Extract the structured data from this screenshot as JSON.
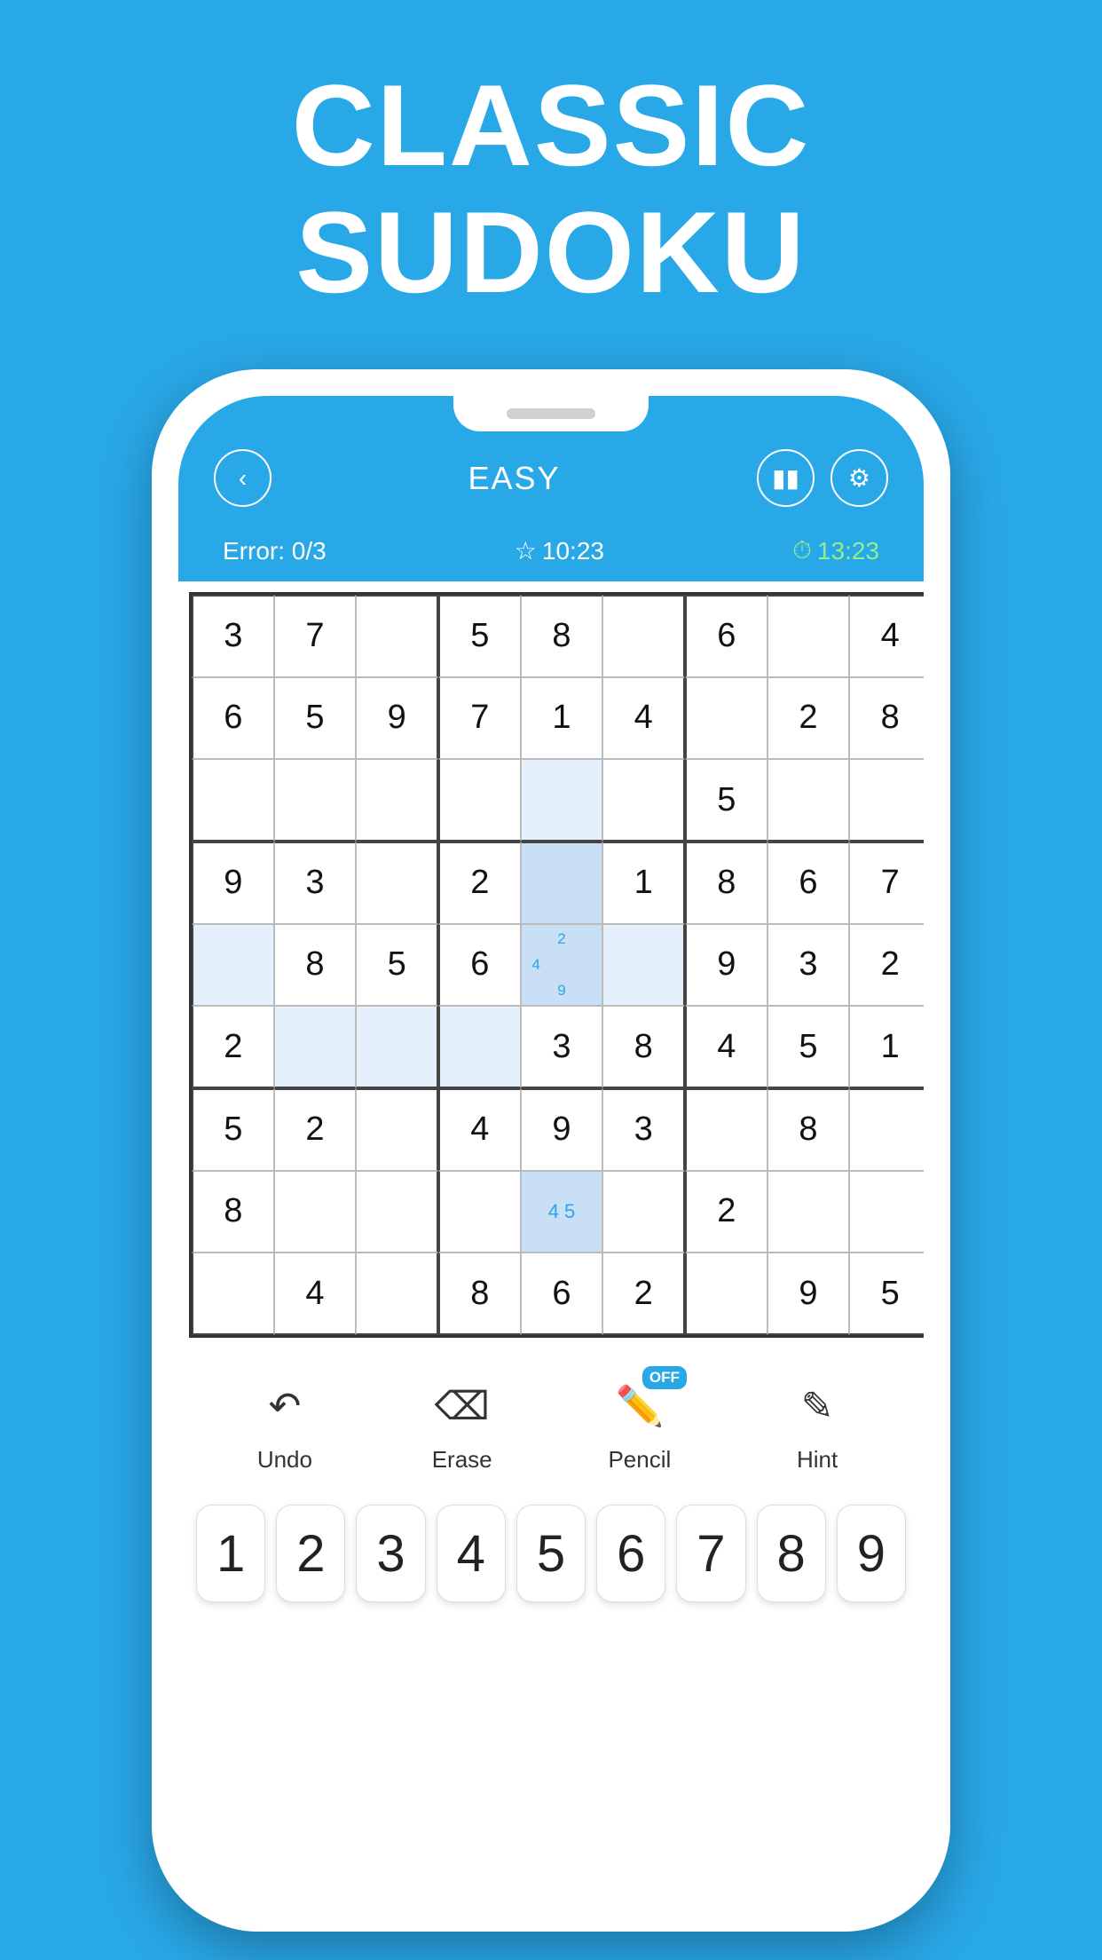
{
  "title": {
    "line1": "CLASSIC",
    "line2": "SUDOKU"
  },
  "header": {
    "difficulty": "EASY",
    "back_label": "‹",
    "pause_label": "⏸",
    "settings_label": "⚙"
  },
  "stats": {
    "error_label": "Error:",
    "error_value": "0/3",
    "best_time": "10:23",
    "current_time": "13:23"
  },
  "grid": {
    "cells": [
      [
        {
          "v": "3",
          "t": "given"
        },
        {
          "v": "7",
          "t": "given"
        },
        {
          "v": "",
          "t": "empty"
        },
        {
          "v": "5",
          "t": "given"
        },
        {
          "v": "8",
          "t": "given"
        },
        {
          "v": "",
          "t": "empty"
        },
        {
          "v": "6",
          "t": "given"
        },
        {
          "v": "",
          "t": "empty"
        },
        {
          "v": "4",
          "t": "given"
        }
      ],
      [
        {
          "v": "6",
          "t": "given"
        },
        {
          "v": "5",
          "t": "given"
        },
        {
          "v": "9",
          "t": "given"
        },
        {
          "v": "7",
          "t": "given"
        },
        {
          "v": "1",
          "t": "given"
        },
        {
          "v": "4",
          "t": "given"
        },
        {
          "v": "",
          "t": "empty"
        },
        {
          "v": "2",
          "t": "given"
        },
        {
          "v": "8",
          "t": "given"
        }
      ],
      [
        {
          "v": "",
          "t": "empty"
        },
        {
          "v": "",
          "t": "empty"
        },
        {
          "v": "",
          "t": "empty"
        },
        {
          "v": "",
          "t": "empty"
        },
        {
          "v": "",
          "t": "highlight"
        },
        {
          "v": "",
          "t": "empty"
        },
        {
          "v": "5",
          "t": "given"
        },
        {
          "v": "",
          "t": "empty"
        },
        {
          "v": "",
          "t": "empty"
        }
      ],
      [
        {
          "v": "9",
          "t": "given"
        },
        {
          "v": "3",
          "t": "given"
        },
        {
          "v": "",
          "t": "empty"
        },
        {
          "v": "2",
          "t": "given"
        },
        {
          "v": "",
          "t": "selected"
        },
        {
          "v": "1",
          "t": "given"
        },
        {
          "v": "8",
          "t": "given"
        },
        {
          "v": "6",
          "t": "given"
        },
        {
          "v": "7",
          "t": "given"
        }
      ],
      [
        {
          "v": "",
          "t": "highlight"
        },
        {
          "v": "8",
          "t": "given"
        },
        {
          "v": "5",
          "t": "given"
        },
        {
          "v": "6",
          "t": "given"
        },
        {
          "v": "pencil",
          "t": "pencil",
          "notes": [
            "",
            "2",
            "",
            "4",
            "",
            "",
            "",
            "9",
            ""
          ]
        },
        {
          "v": "",
          "t": "highlight"
        },
        {
          "v": "9",
          "t": "given"
        },
        {
          "v": "3",
          "t": "given"
        },
        {
          "v": "2",
          "t": "given"
        }
      ],
      [
        {
          "v": "2",
          "t": "given"
        },
        {
          "v": "",
          "t": "highlight"
        },
        {
          "v": "",
          "t": "highlight"
        },
        {
          "v": "",
          "t": "highlight"
        },
        {
          "v": "3",
          "t": "given"
        },
        {
          "v": "8",
          "t": "given"
        },
        {
          "v": "4",
          "t": "given"
        },
        {
          "v": "5",
          "t": "given"
        },
        {
          "v": "1",
          "t": "given"
        }
      ],
      [
        {
          "v": "5",
          "t": "given"
        },
        {
          "v": "2",
          "t": "given"
        },
        {
          "v": "",
          "t": "empty"
        },
        {
          "v": "4",
          "t": "given"
        },
        {
          "v": "9",
          "t": "given"
        },
        {
          "v": "3",
          "t": "given"
        },
        {
          "v": "",
          "t": "empty"
        },
        {
          "v": "8",
          "t": "given"
        },
        {
          "v": "",
          "t": "empty"
        }
      ],
      [
        {
          "v": "8",
          "t": "given"
        },
        {
          "v": "",
          "t": "empty"
        },
        {
          "v": "",
          "t": "empty"
        },
        {
          "v": "",
          "t": "empty"
        },
        {
          "v": "pencil2",
          "t": "pencil2",
          "notes": "4 5"
        },
        {
          "v": "",
          "t": "empty"
        },
        {
          "v": "2",
          "t": "given"
        },
        {
          "v": "",
          "t": "empty"
        },
        {
          "v": "",
          "t": "empty"
        }
      ],
      [
        {
          "v": "",
          "t": "empty"
        },
        {
          "v": "4",
          "t": "given"
        },
        {
          "v": "",
          "t": "empty"
        },
        {
          "v": "8",
          "t": "given"
        },
        {
          "v": "6",
          "t": "given"
        },
        {
          "v": "2",
          "t": "given"
        },
        {
          "v": "",
          "t": "empty"
        },
        {
          "v": "9",
          "t": "given"
        },
        {
          "v": "5",
          "t": "given"
        }
      ]
    ]
  },
  "toolbar": {
    "undo_label": "Undo",
    "erase_label": "Erase",
    "pencil_label": "Pencil",
    "hint_label": "Hint",
    "pencil_state": "OFF"
  },
  "numpad": {
    "digits": [
      "1",
      "2",
      "3",
      "4",
      "5",
      "6",
      "7",
      "8",
      "9"
    ]
  }
}
